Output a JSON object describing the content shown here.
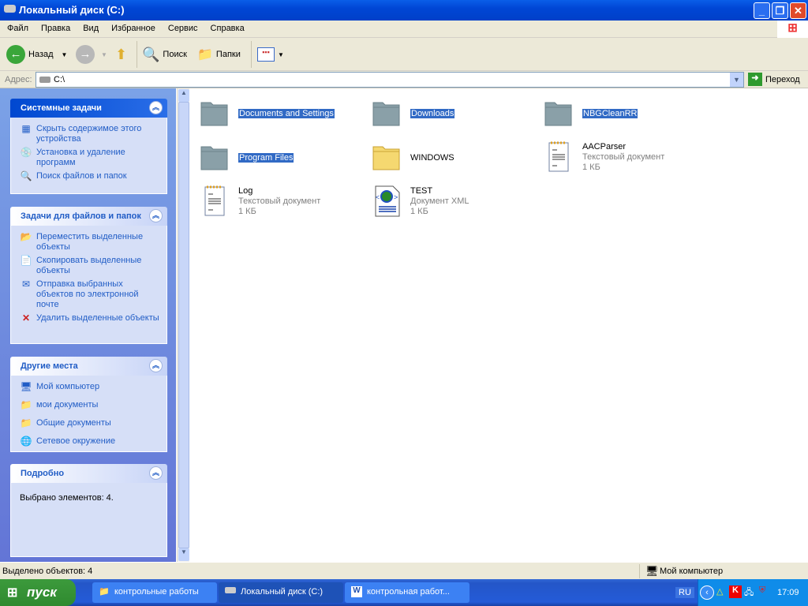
{
  "window": {
    "title": "Локальный диск (C:)"
  },
  "menu": [
    "Файл",
    "Правка",
    "Вид",
    "Избранное",
    "Сервис",
    "Справка"
  ],
  "toolbar": {
    "back": "Назад",
    "search": "Поиск",
    "folders": "Папки"
  },
  "address": {
    "label": "Адрес:",
    "value": "C:\\",
    "go": "Переход"
  },
  "panels": [
    {
      "title": "Системные задачи",
      "items": [
        "Скрыть содержимое этого устройства",
        "Установка и удаление программ",
        "Поиск файлов и папок"
      ]
    },
    {
      "title": "Задачи для файлов и папок",
      "items": [
        "Переместить выделенные объекты",
        "Скопировать выделенные объекты",
        "Отправка выбранных объектов по электронной почте",
        "Удалить выделенные объекты"
      ]
    },
    {
      "title": "Другие места",
      "items": [
        "Мой компьютер",
        "мои документы",
        "Общие документы",
        "Сетевое окружение"
      ]
    },
    {
      "title": "Подробно",
      "text": "Выбрано элементов: 4."
    }
  ],
  "files": [
    {
      "name": "Documents and Settings",
      "selected": true,
      "type": "folder"
    },
    {
      "name": "Downloads",
      "selected": true,
      "type": "folder"
    },
    {
      "name": "NBGCleanRR",
      "selected": true,
      "type": "folder"
    },
    {
      "name": "Program Files",
      "selected": true,
      "type": "folder"
    },
    {
      "name": "WINDOWS",
      "selected": false,
      "type": "folder"
    },
    {
      "name": "AACParser",
      "kind": "Текстовый документ",
      "size": "1 КБ",
      "type": "txt"
    },
    {
      "name": "Log",
      "kind": "Текстовый документ",
      "size": "1 КБ",
      "type": "txt"
    },
    {
      "name": "TEST",
      "kind": "Документ XML",
      "size": "1 КБ",
      "type": "xml"
    }
  ],
  "status": {
    "left": "Выделено объектов: 4",
    "right": "Мой компьютер"
  },
  "taskbar": {
    "start": "пуск",
    "tasks": [
      "контрольные работы",
      "Локальный диск (C:)",
      "контрольная работ..."
    ],
    "lang": "RU",
    "clock": "17:09"
  }
}
